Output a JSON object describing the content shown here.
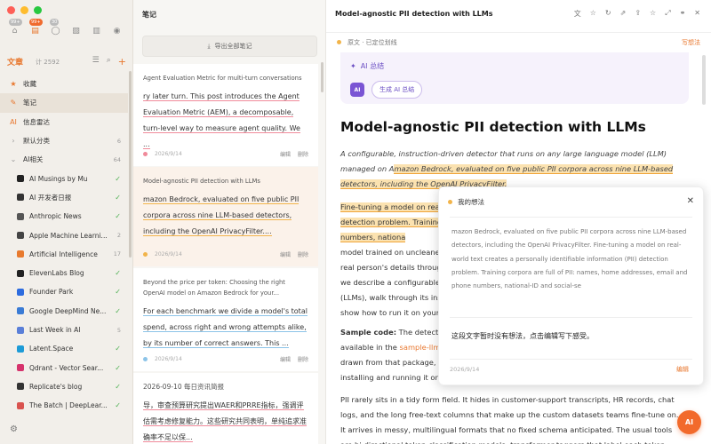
{
  "sidebar": {
    "icons": [
      {
        "name": "home-icon",
        "glyph": "⌂",
        "badge": "99+"
      },
      {
        "name": "notes-icon",
        "glyph": "▤",
        "badge": "99+"
      },
      {
        "name": "chat-icon",
        "glyph": "◯",
        "badge": "30"
      },
      {
        "name": "image-icon",
        "glyph": "▧",
        "badge": ""
      },
      {
        "name": "book-icon",
        "glyph": "▥",
        "badge": ""
      },
      {
        "name": "mic-icon",
        "glyph": "◉",
        "badge": ""
      }
    ],
    "header_title": "文章",
    "header_count": "计 2592",
    "items": [
      {
        "label": "收藏",
        "count": "",
        "icon": "★",
        "type": "top"
      },
      {
        "label": "笔记",
        "count": "",
        "icon": "✎",
        "type": "top",
        "selected": true
      },
      {
        "label": "信息雷达",
        "count": "",
        "icon": "AI",
        "type": "top"
      },
      {
        "label": "默认分类",
        "count": "6",
        "icon": "›",
        "type": "group"
      },
      {
        "label": "AI相关",
        "count": "64",
        "icon": "⌄",
        "type": "group"
      },
      {
        "label": "AI Musings by Mu",
        "count": "✓",
        "type": "feed",
        "color": "#222"
      },
      {
        "label": "AI 开发者日报",
        "count": "✓",
        "type": "feed",
        "color": "#333"
      },
      {
        "label": "Anthropic News",
        "count": "✓",
        "type": "feed",
        "color": "#555"
      },
      {
        "label": "Apple Machine Learni...",
        "count": "2",
        "type": "feed",
        "color": "#444"
      },
      {
        "label": "Artificial Intelligence",
        "count": "17",
        "type": "feed",
        "color": "#e87a2e"
      },
      {
        "label": "ElevenLabs Blog",
        "count": "✓",
        "type": "feed",
        "color": "#222"
      },
      {
        "label": "Founder Park",
        "count": "✓",
        "type": "feed",
        "color": "#2d6cdf"
      },
      {
        "label": "Google DeepMind Ne...",
        "count": "✓",
        "type": "feed",
        "color": "#3a7bd5"
      },
      {
        "label": "Last Week in AI",
        "count": "5",
        "type": "feed",
        "color": "#5a7fd8"
      },
      {
        "label": "Latent.Space",
        "count": "✓",
        "type": "feed",
        "color": "#1d9bd7"
      },
      {
        "label": "Qdrant - Vector Sear...",
        "count": "✓",
        "type": "feed",
        "color": "#d6336c"
      },
      {
        "label": "Replicate's blog",
        "count": "✓",
        "type": "feed",
        "color": "#333"
      },
      {
        "label": "The Batch | DeepLear...",
        "count": "✓",
        "type": "feed",
        "color": "#d9534f"
      }
    ]
  },
  "middle": {
    "title": "笔记",
    "export_label": "导出全部笔记",
    "edit_label": "编辑",
    "delete_label": "删除",
    "cards": [
      {
        "title": "Agent Evaluation Metric for multi-turn conversations",
        "body": "ry later turn. This post introduces the Agent Evaluation Metric (AEM), a decomposable, turn-level way to measure agent quality. We ...",
        "date": "2026/9/14",
        "color": "#f08a9a"
      },
      {
        "title": "Model-agnostic PII detection with LLMs",
        "body": "mazon Bedrock, evaluated on five public PII corpora across nine LLM-based detectors, including the OpenAI PrivacyFilter....",
        "date": "2026/9/14",
        "color": "#f2b44a"
      },
      {
        "title": "Beyond the price per token: Choosing the right OpenAI model on Amazon Bedrock for your...",
        "body": "For each benchmark we divide a model's total spend, across right and wrong attempts alike, by its number of correct answers. This ...",
        "date": "2026/9/14",
        "color": "#8cc4e8"
      },
      {
        "title": "2026-09-10 每日资讯简报",
        "body": "导，审查预算研究提出WAER和PRRE指标，强调评估需考虑修复能力。这些研究共同表明，单纯追求准确率不足以保...",
        "date": "",
        "color": "#f08a9a"
      }
    ]
  },
  "main": {
    "title": "Model-agnostic PII detection with LLMs",
    "toolbar_icons": [
      "translate-icon",
      "star-icon",
      "refresh-icon",
      "open-external-icon",
      "share-icon",
      "bookmark-icon",
      "expand-icon",
      "link-icon",
      "close-icon"
    ],
    "source_status": "原文 · 已定位划线",
    "highlight_label": "写想法",
    "ai_summary_title": "AI 总结",
    "ai_avatar": "AI",
    "ai_generate": "生成 AI 总结",
    "article_title": "Model-agnostic PII detection with LLMs",
    "intro_plain": "A configurable, instruction-driven detector that runs on any large language model (LLM) managed on A",
    "intro_mark": "mazon Bedrock, evaluated on five public PII corpora across nine LLM-based detectors, including the OpenAI PrivacyFilter.",
    "p2_mark": "Fine-tuning a model on real-world text creates a personally identifiable information (PII) detection problem. Traini",
    "p2_tail": "ng corpora are full of PII: names, home addresses, email and phone numbers, nationa",
    "p2_lines": [
      "model trained on uncleaned data may memorize and reproduce",
      "real person's details through careful prompting. In this post",
      "we describe a configurable detector that works with any LLM",
      "(LLMs), walk through its instruction-driven design, and",
      "show how to run it on your own data."
    ],
    "sample_label": "Sample code:",
    "sample_text": " The detector and evaluation harness are",
    "sample_line2a": "available in the ",
    "sample_link": "sample-llm-pii-detector",
    "sample_line3": "drawn from that package, so you can follow along by",
    "sample_line4": "installing and running it on your own data.",
    "p4_lines": [
      "PII rarely sits in a tidy form field. It hides in customer-support transcripts, HR records, chat",
      "logs, and the long free-text columns that make up the custom datasets teams fine-tune on.",
      "It arrives in messy, multilingual formats that no fixed schema anticipated. The usual tools",
      "are bi-directional token-classification models: transformer taggers that label each token"
    ]
  },
  "popup": {
    "title": "我的想法",
    "quote": "mazon Bedrock, evaluated on five public PII corpora across nine LLM-based detectors, including the OpenAI PrivacyFilter. Fine-tuning a model on real-world text creates a personally identifiable information (PII) detection problem. Training corpora are full of PII: names, home addresses, email and phone numbers, national-ID and social-se",
    "thought": "这段文字暂时没有想法，点击编辑写下感受。",
    "date": "2026/9/14",
    "edit": "编辑"
  },
  "fab_label": "AI",
  "colors": {
    "accent": "#e8772e",
    "purple": "#6b4fc4"
  }
}
